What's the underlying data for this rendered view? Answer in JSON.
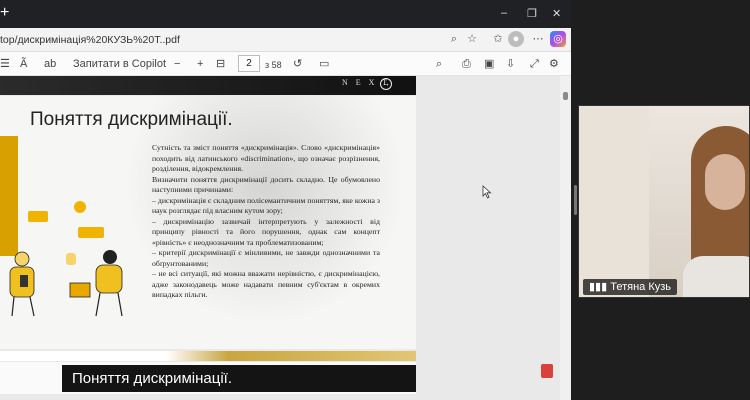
{
  "browser": {
    "url": "top/дискримінація%20КУЗЬ%20Т..pdf",
    "new_tab_symbol": "+",
    "window_controls": {
      "minimize": "–",
      "restore": "❐",
      "close": "✕"
    }
  },
  "pdf_toolbar": {
    "read_aloud_icon": "Ã",
    "translate_icon": "ab",
    "copilot_label": "Запитати в Copilot",
    "zoom_out": "−",
    "zoom_in": "+",
    "current_page": "2",
    "total_pages": "з 58"
  },
  "slide": {
    "nav_label": "N E X T",
    "nav_arrow": "→",
    "title": "Поняття дискримінації.",
    "body": [
      "Сутність та зміст поняття «дискримінація». Слово «дискримінація» походить від латинського «discrimination», що означає розрізнення, розділення, відокремлення.",
      "Визначити поняття дискримінації досить складно. Це обумовлено наступними причинами:",
      "– дискримінація є складним полісемантичним поняттям, яке кожна з наук розглядає під власним кутом зору;",
      "– дискримінацію зазвичай інтерпретують у залежності від принципу рівності та його порушення, однак сам концепт «рівність» є неоднозначним та проблематизованим;",
      "– критерії дискримінації є мінливими, не завжди однозначними та обґрунтованими;",
      "– не всі ситуації, які можна вважати нерівністю, є дискримінацією, адже законодавець може надавати певним суб'єктам в окремих випадках пільги."
    ],
    "subtitle": "Поняття дискримінації."
  },
  "video": {
    "participant_name": "Тетяна Кузь"
  },
  "colors": {
    "accent_gold": "#d8a000",
    "dark": "#141414"
  }
}
